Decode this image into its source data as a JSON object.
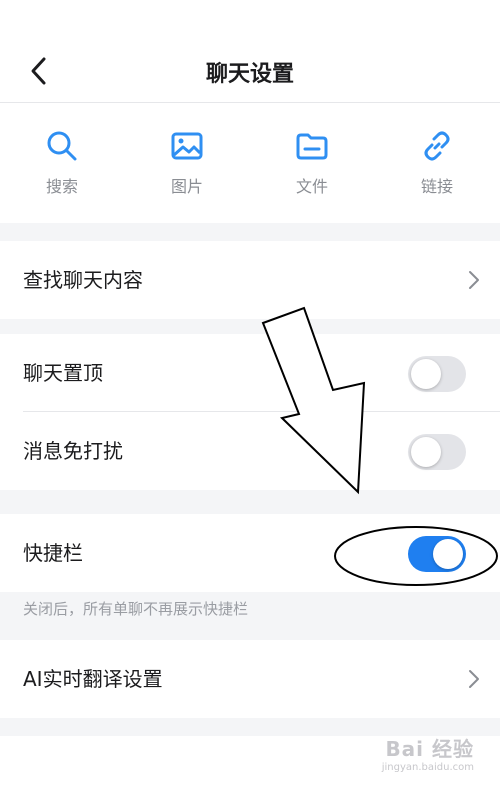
{
  "header": {
    "title": "聊天设置"
  },
  "shortcuts": [
    {
      "label": "搜索",
      "icon": "search-icon"
    },
    {
      "label": "图片",
      "icon": "image-icon"
    },
    {
      "label": "文件",
      "icon": "folder-icon"
    },
    {
      "label": "链接",
      "icon": "link-icon"
    }
  ],
  "rows": {
    "find_content": {
      "label": "查找聊天内容"
    },
    "pin_chat": {
      "label": "聊天置顶",
      "enabled": false
    },
    "mute": {
      "label": "消息免打扰",
      "enabled": false
    },
    "quick_bar": {
      "label": "快捷栏",
      "enabled": true
    },
    "quick_bar_hint": "关闭后，所有单聊不再展示快捷栏",
    "ai_translate": {
      "label": "AI实时翻译设置"
    }
  },
  "colors": {
    "accent": "#1f7ff0",
    "icon_blue": "#2f8ff2",
    "toggle_off": "#e3e4e8"
  },
  "watermark": {
    "main": "Bai 经验",
    "sub": "jingyan.baidu.com"
  }
}
